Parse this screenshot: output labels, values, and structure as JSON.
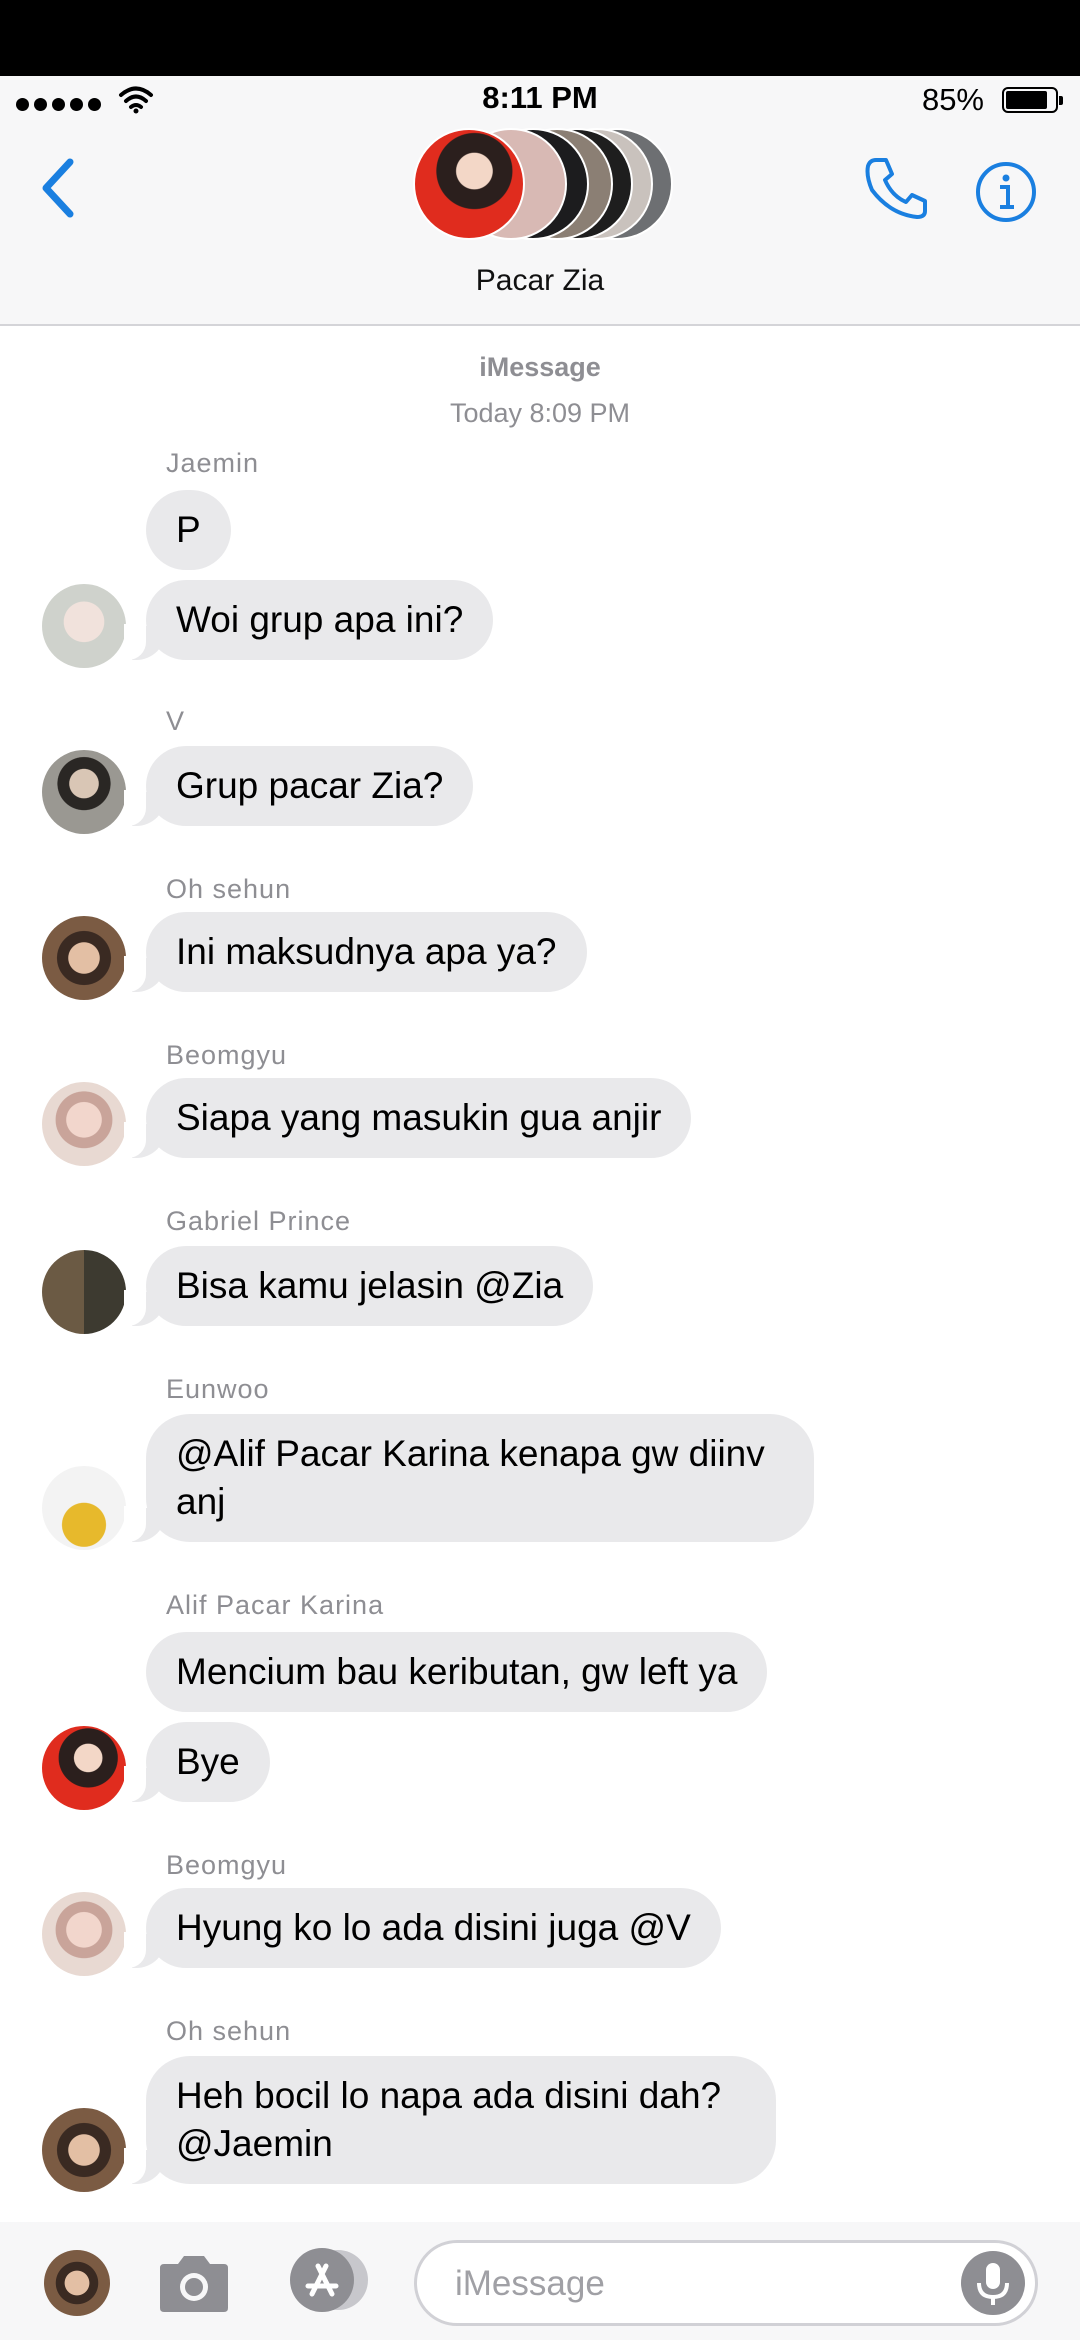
{
  "status": {
    "time": "8:11 PM",
    "battery": "85%",
    "battery_level": 0.85
  },
  "header": {
    "group_name": "Pacar Zia"
  },
  "thread": {
    "service": "iMessage",
    "timestamp": "Today 8:09 PM"
  },
  "messages": [
    {
      "sender": "Jaemin",
      "texts": [
        "P",
        "Woi grup apa ini?"
      ]
    },
    {
      "sender": "V",
      "texts": [
        "Grup pacar Zia?"
      ]
    },
    {
      "sender": "Oh sehun",
      "texts": [
        "Ini maksudnya apa ya?"
      ]
    },
    {
      "sender": "Beomgyu",
      "texts": [
        "Siapa yang masukin gua anjir"
      ]
    },
    {
      "sender": "Gabriel Prince",
      "texts": [
        "Bisa kamu jelasin @Zia"
      ]
    },
    {
      "sender": "Eunwoo",
      "texts": [
        "@Alif Pacar Karina kenapa gw diinv anj"
      ]
    },
    {
      "sender": "Alif Pacar Karina",
      "texts": [
        "Mencium bau keributan, gw left ya",
        "Bye"
      ]
    },
    {
      "sender": "Beomgyu",
      "texts": [
        "Hyung ko lo ada disini juga @V"
      ]
    },
    {
      "sender": "Oh sehun",
      "texts": [
        "Heh bocil lo napa ada disini dah? @Jaemin"
      ]
    }
  ],
  "input": {
    "placeholder": "iMessage"
  },
  "colors": {
    "accent": "#1a7fe0",
    "bubble": "#e9e9eb",
    "meta": "#8e8e93"
  },
  "icons": [
    "back-chevron-icon",
    "phone-icon",
    "info-icon",
    "camera-icon",
    "appstore-icon",
    "microphone-icon"
  ]
}
